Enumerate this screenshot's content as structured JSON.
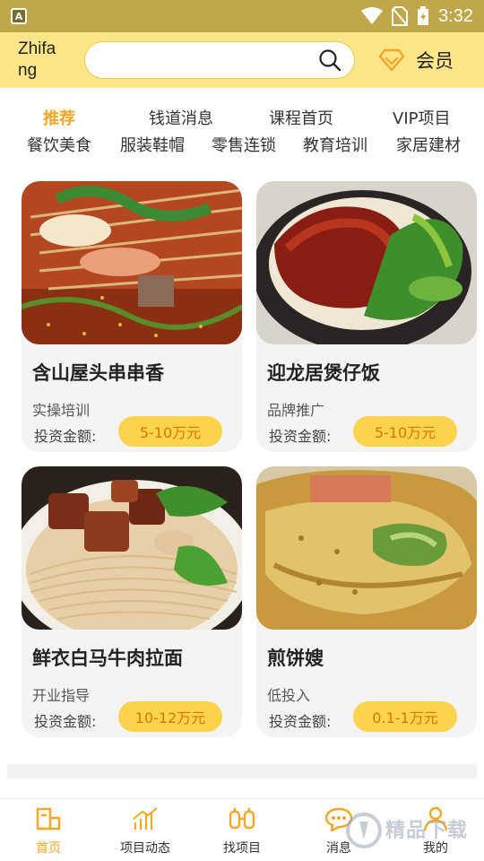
{
  "status_bar": {
    "time": "3:32",
    "app_badge": "A"
  },
  "header": {
    "brand": "Zhifang",
    "search_placeholder": "",
    "vip_label": "会员"
  },
  "tabs": [
    {
      "label": "推荐",
      "active": true
    },
    {
      "label": "钱道消息",
      "active": false
    },
    {
      "label": "课程首页",
      "active": false
    },
    {
      "label": "VIP项目",
      "active": false
    }
  ],
  "categories": [
    "餐饮美食",
    "服装鞋帽",
    "零售连锁",
    "教育培训",
    "家居建材"
  ],
  "cards": [
    {
      "title": "含山屋头串串香",
      "tag": "实操培训",
      "invest_label": "投资金额:",
      "price": "5-10万元",
      "image_icon": "skewer-hotpot-photo"
    },
    {
      "title": "迎龙居煲仔饭",
      "tag": "品牌推广",
      "invest_label": "投资金额:",
      "price": "5-10万元",
      "image_icon": "claypot-rice-photo"
    },
    {
      "title": "鲜衣白马牛肉拉面",
      "tag": "开业指导",
      "invest_label": "投资金额:",
      "price": "10-12万元",
      "image_icon": "beef-noodle-photo"
    },
    {
      "title": "煎饼嫂",
      "tag": "低投入",
      "invest_label": "投资金额:",
      "price": "0.1-1万元",
      "image_icon": "jianbing-photo"
    }
  ],
  "bottom_nav": [
    {
      "label": "首页",
      "icon": "home-icon",
      "active": true
    },
    {
      "label": "项目动态",
      "icon": "trend-chart-icon",
      "active": false
    },
    {
      "label": "找项目",
      "icon": "binoculars-icon",
      "active": false
    },
    {
      "label": "消息",
      "icon": "chat-bubble-icon",
      "active": false
    },
    {
      "label": "我的",
      "icon": "person-icon",
      "active": false
    }
  ],
  "watermark": {
    "text": "精品下载"
  },
  "colors": {
    "status_bar": "#bfa74a",
    "header": "#fde58a",
    "accent": "#f5a623",
    "price_bg": "#fcd34d",
    "price_text": "#d97706"
  }
}
